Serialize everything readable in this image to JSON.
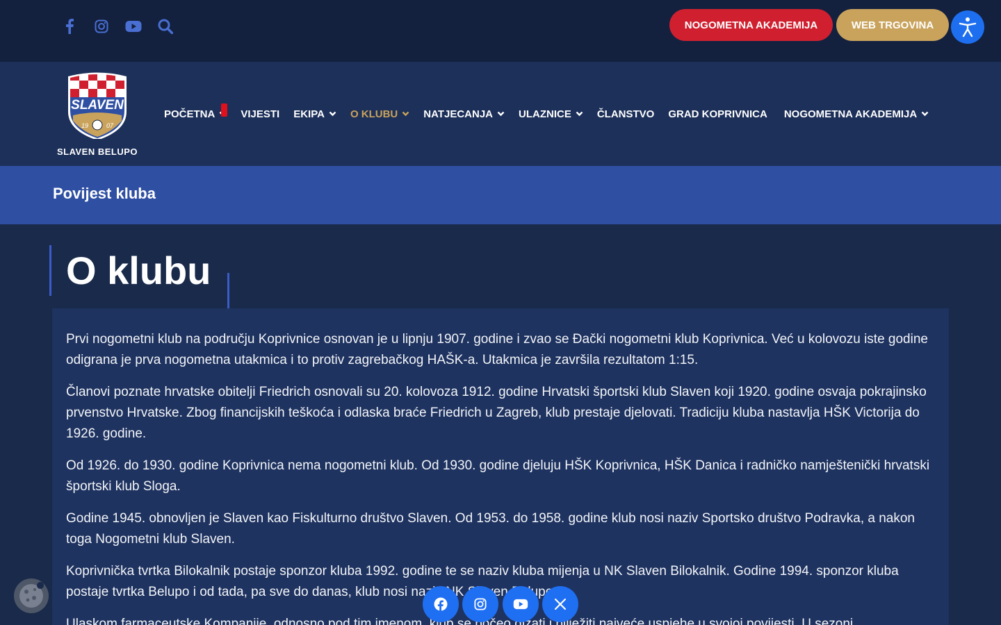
{
  "topbar": {
    "social_icons": [
      "facebook-icon",
      "instagram-icon",
      "youtube-icon",
      "search-icon"
    ],
    "icon_color": "#4a6fd3",
    "academy_button": "NOGOMETNA AKADEMIJA",
    "shop_button": "WEB TRGOVINA",
    "accessibility_icon": "accessibility-icon"
  },
  "logo": {
    "text": "SLAVEN BELUPO",
    "crest_name": "SLAVEN",
    "crest_year_left": "19",
    "crest_year_right": "07"
  },
  "nav": {
    "items": [
      {
        "label": "POČETNA",
        "dropdown": true
      },
      {
        "label": "VIJESTI",
        "dropdown": false
      },
      {
        "label": "EKIPA",
        "dropdown": true
      },
      {
        "label": "O KLUBU",
        "dropdown": true,
        "active": true
      },
      {
        "label": "NATJECANJA",
        "dropdown": true
      },
      {
        "label": "ULAZNICE",
        "dropdown": true
      },
      {
        "label": "ČLANSTVO",
        "dropdown": false
      },
      {
        "label": "GRAD KOPRIVNICA",
        "dropdown": false
      },
      {
        "label": "NOGOMETNA AKADEMIJA",
        "dropdown": true
      }
    ],
    "active_color": "#c9a35c"
  },
  "subheader": {
    "title": "Povijest kluba"
  },
  "main": {
    "heading": "O klubu",
    "paragraphs": [
      "Prvi nogometni klub na području Koprivnice osnovan je u lipnju 1907. godine i zvao se Đački nogometni klub Koprivnica. Već u kolovozu iste godine odigrana je prva nogometna utakmica i to protiv zagrebačkog HAŠK-a. Utakmica je završila rezultatom 1:15.",
      "Članovi poznate hrvatske obitelji Friedrich osnovali su 20. kolovoza 1912. godine Hrvatski športski klub Slaven koji 1920. godine osvaja pokrajinsko prvenstvo Hrvatske. Zbog financijskih teškoća i odlaska braće Friedrich u Zagreb, klub prestaje djelovati. Tradiciju kluba nastavlja HŠK Victorija do 1926. godine.",
      "Od 1926. do 1930. godine Koprivnica nema nogometni klub. Od 1930. godine djeluju HŠK Koprivnica, HŠK Danica i radničko namještenički hrvatski športski klub Sloga.",
      "Godine 1945. obnovljen je Slaven kao Fiskulturno društvo Slaven. Od 1953. do 1958. godine klub nosi naziv Sportsko društvo Podravka, a nakon toga Nogometni klub Slaven.",
      "Koprivnička tvrtka Bilokalnik postaje sponzor kluba 1992. godine te se naziv kluba mijenja u NK Slaven Bilokalnik. Godine 1994. sponzor kluba postaje tvrtka Belupo i od tada, pa sve do danas, klub nosi naziv NK Slaven Belupo.",
      "Ulaskom farmaceutske Kompanije, odnosno pod tim imenom, klub se počeo dizati i bilježiti najveće uspjehe u svojoj povijesti. U sezoni"
    ]
  },
  "floating": {
    "cookie_icon": "cookie-icon",
    "share_icons": [
      "facebook-icon",
      "instagram-icon",
      "youtube-icon",
      "x-icon"
    ],
    "share_color": "#1f6ff2"
  }
}
